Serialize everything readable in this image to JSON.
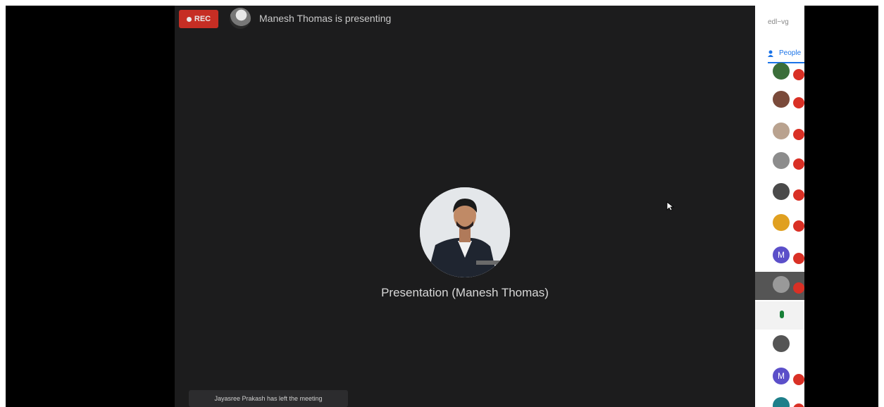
{
  "meeting": {
    "rec_label": "REC",
    "presenting_banner": "Manesh Thomas is presenting",
    "presentation_label": "Presentation (Manesh Thomas)",
    "toast": "Jayasree Prakash has left the meeting"
  },
  "sidebar": {
    "search_text": "edl~vg",
    "people_tab": "People",
    "participants": [
      {
        "avatar": "photo",
        "color": "#3b6e3a"
      },
      {
        "avatar": "photo",
        "color": "#7a4a3a"
      },
      {
        "avatar": "photo",
        "color": "#b9a28f"
      },
      {
        "avatar": "photo",
        "color": "#8c8c8c"
      },
      {
        "avatar": "photo",
        "color": "#4a4a4a"
      },
      {
        "avatar": "photo",
        "color": "#e0a020"
      },
      {
        "avatar": "initial",
        "initial": "M",
        "color": "#5b4fc9"
      },
      {
        "avatar": "photo",
        "color": "#999999"
      },
      {
        "avatar": "mic",
        "color": "#188038"
      },
      {
        "avatar": "photo",
        "color": "#555555"
      },
      {
        "avatar": "initial",
        "initial": "M",
        "color": "#5b4fc9"
      },
      {
        "avatar": "photo",
        "color": "#1e7f8a"
      }
    ]
  }
}
